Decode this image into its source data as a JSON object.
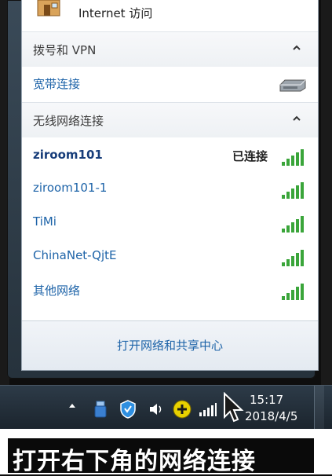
{
  "flyout": {
    "internet_label": "Internet 访问",
    "dialup_section": {
      "title": "拨号和 VPN",
      "connections": [
        {
          "label": "宽带连接",
          "icon": "broadband-icon"
        }
      ]
    },
    "wireless_section": {
      "title": "无线网络连接",
      "networks": [
        {
          "name": "ziroom101",
          "status": "已连接",
          "connected": true
        },
        {
          "name": "ziroom101-1",
          "status": "",
          "connected": false
        },
        {
          "name": "TiMi",
          "status": "",
          "connected": false
        },
        {
          "name": "ChinaNet-QjtE",
          "status": "",
          "connected": false
        },
        {
          "name": "其他网络",
          "status": "",
          "connected": false
        }
      ]
    },
    "footer_link": "打开网络和共享中心"
  },
  "taskbar": {
    "time": "15:17",
    "date": "2018/4/5",
    "tray_icons": [
      "tray-expand-arrow-icon",
      "usb-icon",
      "shield-icon",
      "volume-icon",
      "plus-icon",
      "network-signal-icon"
    ]
  },
  "caption": {
    "text": "打开右下角的网络连接"
  },
  "colors": {
    "link_blue": "#1d63a8",
    "signal_green": "#3aa53a",
    "taskbar": "#1b242d"
  }
}
